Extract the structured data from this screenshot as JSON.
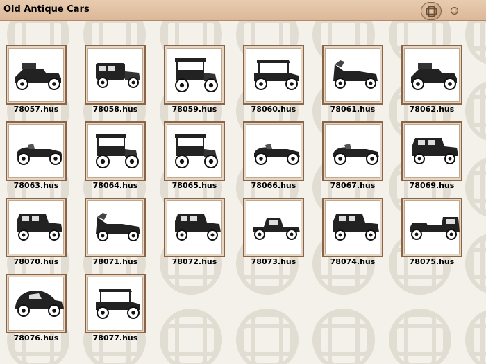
{
  "window": {
    "title": "Old Antique Cars"
  },
  "icons": {
    "title_knob": "celtic-knot-icon",
    "corner_button": "round-button-icon"
  },
  "files": [
    {
      "name": "78057.hus",
      "style": "runabout"
    },
    {
      "name": "78058.hus",
      "style": "limousine"
    },
    {
      "name": "78059.hus",
      "style": "tall-coach"
    },
    {
      "name": "78060.hus",
      "style": "touring-top"
    },
    {
      "name": "78061.hus",
      "style": "open-tourer"
    },
    {
      "name": "78062.hus",
      "style": "runabout"
    },
    {
      "name": "78063.hus",
      "style": "roadster"
    },
    {
      "name": "78064.hus",
      "style": "tall-coach"
    },
    {
      "name": "78065.hus",
      "style": "tall-coach"
    },
    {
      "name": "78066.hus",
      "style": "roadster"
    },
    {
      "name": "78067.hus",
      "style": "roadster"
    },
    {
      "name": "78069.hus",
      "style": "sedan"
    },
    {
      "name": "78070.hus",
      "style": "sedan"
    },
    {
      "name": "78071.hus",
      "style": "open-tourer"
    },
    {
      "name": "78072.hus",
      "style": "sedan"
    },
    {
      "name": "78073.hus",
      "style": "coupe"
    },
    {
      "name": "78074.hus",
      "style": "sedan"
    },
    {
      "name": "78075.hus",
      "style": "long-limo"
    },
    {
      "name": "78076.hus",
      "style": "fastback"
    },
    {
      "name": "78077.hus",
      "style": "touring-top"
    }
  ]
}
